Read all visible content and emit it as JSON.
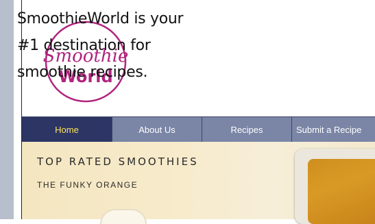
{
  "intro": {
    "line1": "SmoothieWorld is your",
    "line2": "#1 destination for",
    "line3": "smoothie recipes."
  },
  "logo": {
    "word1": "Smoothie",
    "word2": "World",
    "color": "#b0247e"
  },
  "nav": {
    "items": [
      {
        "label": "Home",
        "active": true
      },
      {
        "label": "About Us",
        "active": false
      },
      {
        "label": "Recipes",
        "active": false
      },
      {
        "label": "Submit a Recipe",
        "active": false
      }
    ]
  },
  "main": {
    "heading": "TOP RATED SMOOTHIES",
    "subheading": "THE FUNKY ORANGE"
  },
  "colors": {
    "nav_active_bg": "#2d3565",
    "nav_active_text": "#ffe65a",
    "nav_bg": "#7b86a6",
    "content_bg": "#f4e6c0"
  }
}
